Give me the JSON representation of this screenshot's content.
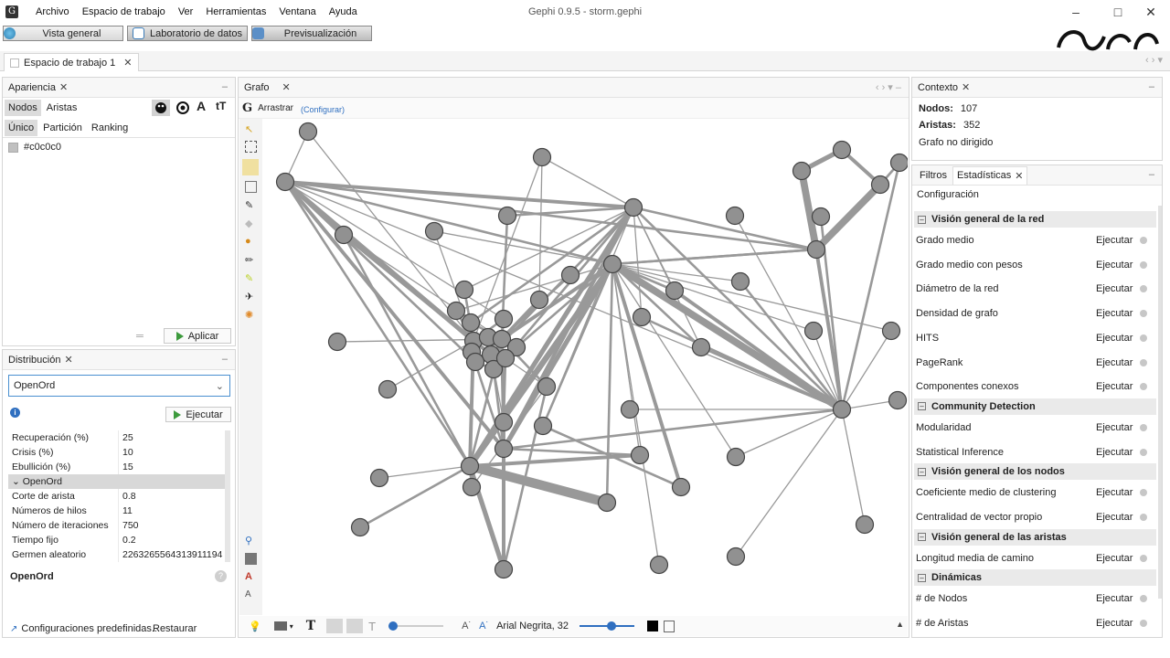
{
  "window": {
    "title": "Gephi 0.9.5 - storm.gephi"
  },
  "menu": [
    "Archivo",
    "Espacio de trabajo",
    "Ver",
    "Herramientas",
    "Ventana",
    "Ayuda"
  ],
  "modes": {
    "overview": "Vista general",
    "datalab": "Laboratorio de datos",
    "preview": "Previsualización"
  },
  "workspace_tab": "Espacio de trabajo 1",
  "appearance": {
    "title": "Apariencia",
    "tabs": [
      "Nodos",
      "Aristas"
    ],
    "subtabs": [
      "Único",
      "Partición",
      "Ranking"
    ],
    "color_value": "#c0c0c0",
    "apply": "Aplicar"
  },
  "layout": {
    "title": "Distribución",
    "algorithm": "OpenOrd",
    "run": "Ejecutar",
    "rows": [
      {
        "k": "Recuperación (%)",
        "v": "25"
      },
      {
        "k": "Crisis (%)",
        "v": "10"
      },
      {
        "k": "Ebullición (%)",
        "v": "15"
      }
    ],
    "group": "OpenOrd",
    "rows2": [
      {
        "k": "Corte de arista",
        "v": "0.8"
      },
      {
        "k": "Números de hilos",
        "v": "11"
      },
      {
        "k": "Número de iteraciones",
        "v": "750"
      },
      {
        "k": "Tiempo fijo",
        "v": "0.2"
      },
      {
        "k": "Germen aleatorio",
        "v": "2263265564313911194"
      }
    ],
    "description_title": "OpenOrd",
    "presets": "Configuraciones predefinidas...",
    "restore": "Restaurar"
  },
  "graph": {
    "tab": "Grafo",
    "mode": "Arrastrar",
    "configure": "(Configurar)",
    "font_label": "Arial Negrita, 32"
  },
  "context": {
    "title": "Contexto",
    "nodes_label": "Nodos:",
    "nodes": "107",
    "edges_label": "Aristas:",
    "edges": "352",
    "type": "Grafo no dirigido"
  },
  "stats": {
    "tab_filters": "Filtros",
    "tab_stats": "Estadísticas",
    "settings": "Configuración",
    "run": "Ejecutar",
    "sections": [
      {
        "title": "Visión general de la red",
        "items": [
          "Grado medio",
          "Grado medio con pesos",
          "Diámetro de la red",
          "Densidad de grafo",
          "HITS",
          "PageRank",
          "Componentes conexos"
        ]
      },
      {
        "title": "Community Detection",
        "items": [
          "Modularidad",
          "Statistical Inference"
        ]
      },
      {
        "title": "Visión general de los nodos",
        "items": [
          "Coeficiente medio de clustering",
          "Centralidad de vector propio"
        ]
      },
      {
        "title": "Visión general de las aristas",
        "items": [
          "Longitud media de camino"
        ]
      },
      {
        "title": "Dinámicas",
        "items": [
          "# de Nodos",
          "# de Aristas"
        ]
      }
    ]
  }
}
